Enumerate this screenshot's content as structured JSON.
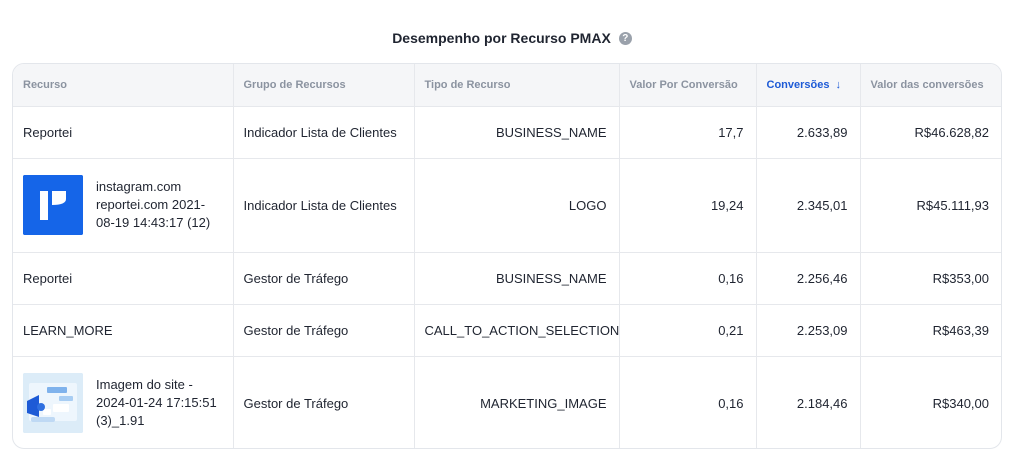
{
  "title": "Desempenho por Recurso PMAX",
  "help_icon": "?",
  "columns": [
    {
      "label": "Recurso"
    },
    {
      "label": "Grupo de Recursos"
    },
    {
      "label": "Tipo de Recurso"
    },
    {
      "label": "Valor Por Conversão"
    },
    {
      "label": "Conversões",
      "sort_arrow": "↓"
    },
    {
      "label": "Valor das conversões"
    }
  ],
  "accent_color": "#1d5ad6",
  "rows": [
    {
      "asset": "Reportei",
      "group": "Indicador Lista de Clientes",
      "type": "BUSINESS_NAME",
      "value_per_conv": "17,7",
      "conversions": "2.633,89",
      "conv_value": "R$46.628,82"
    },
    {
      "asset": "instagram.com reportei.com 2021-08-19 14:43:17 (12)",
      "thumbnail": "reportei-logo-icon",
      "group": "Indicador Lista de Clientes",
      "type": "LOGO",
      "value_per_conv": "19,24",
      "conversions": "2.345,01",
      "conv_value": "R$45.111,93"
    },
    {
      "asset": "Reportei",
      "group": "Gestor de Tráfego",
      "type": "BUSINESS_NAME",
      "value_per_conv": "0,16",
      "conversions": "2.256,46",
      "conv_value": "R$353,00"
    },
    {
      "asset": "LEARN_MORE",
      "group": "Gestor de Tráfego",
      "type": "CALL_TO_ACTION_SELECTION",
      "value_per_conv": "0,21",
      "conversions": "2.253,09",
      "conv_value": "R$463,39"
    },
    {
      "asset": "Imagem do site - 2024-01-24 17:15:51 (3)_1.91",
      "thumbnail": "site-illustration-image",
      "group": "Gestor de Tráfego",
      "type": "MARKETING_IMAGE",
      "value_per_conv": "0,16",
      "conversions": "2.184,46",
      "conv_value": "R$340,00"
    }
  ]
}
